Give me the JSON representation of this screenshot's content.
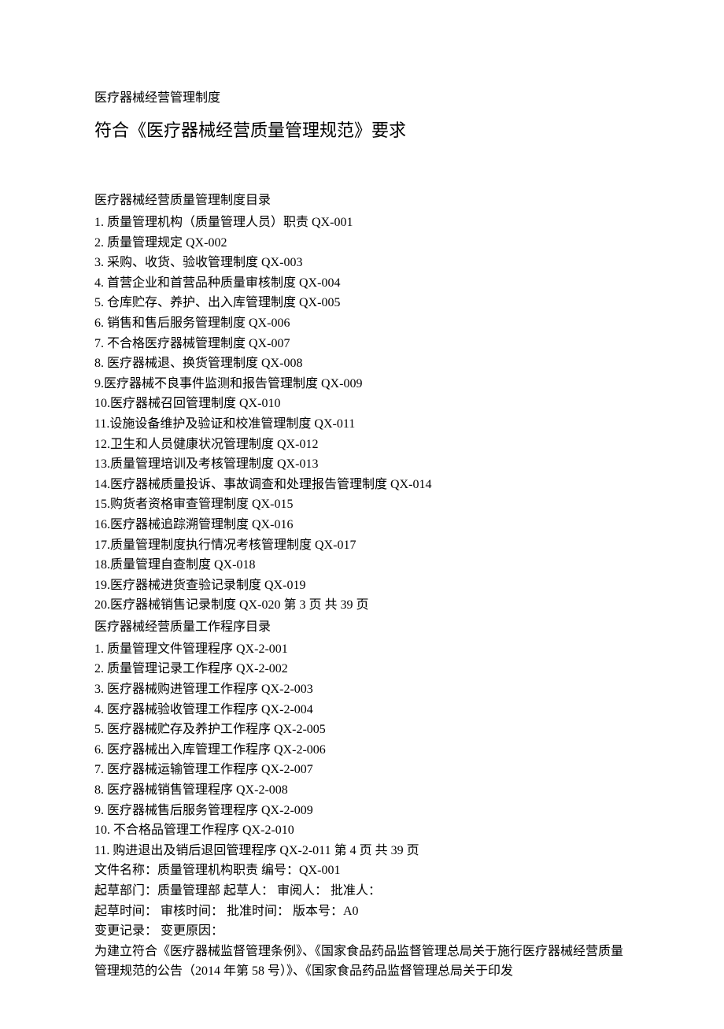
{
  "title_small": "医疗器械经营管理制度",
  "title_large": "符合《医疗器械经营质量管理规范》要求",
  "toc1_heading": "医疗器械经营质量管理制度目录",
  "toc1": {
    "i1": "1. 质量管理机构（质量管理人员）职责 QX-001",
    "i2": "2. 质量管理规定 QX-002",
    "i3": "3. 采购、收货、验收管理制度 QX-003",
    "i4": "4. 首营企业和首营品种质量审核制度 QX-004",
    "i5": "5. 仓库贮存、养护、出入库管理制度 QX-005",
    "i6": "6. 销售和售后服务管理制度 QX-006",
    "i7": "7. 不合格医疗器械管理制度 QX-007",
    "i8": "8. 医疗器械退、换货管理制度 QX-008",
    "i9": "9.医疗器械不良事件监测和报告管理制度 QX-009",
    "i10": "10.医疗器械召回管理制度 QX-010",
    "i11": "11.设施设备维护及验证和校准管理制度 QX-011",
    "i12": "12.卫生和人员健康状况管理制度 QX-012",
    "i13": "13.质量管理培训及考核管理制度 QX-013",
    "i14": "14.医疗器械质量投诉、事故调查和处理报告管理制度 QX-014",
    "i15": "15.购货者资格审查管理制度 QX-015",
    "i16": "16.医疗器械追踪溯管理制度 QX-016",
    "i17": "17.质量管理制度执行情况考核管理制度 QX-017",
    "i18": "18.质量管理自查制度 QX-018",
    "i19": "19.医疗器械进货查验记录制度 QX-019",
    "i20": "20.医疗器械销售记录制度 QX-020 第 3 页 共 39 页"
  },
  "toc2_heading": "医疗器械经营质量工作程序目录",
  "toc2": {
    "i1": "1. 质量管理文件管理程序 QX-2-001",
    "i2": "2. 质量管理记录工作程序 QX-2-002",
    "i3": "3. 医疗器械购进管理工作程序 QX-2-003",
    "i4": "4. 医疗器械验收管理工作程序 QX-2-004",
    "i5": "5. 医疗器械贮存及养护工作程序 QX-2-005",
    "i6": "6. 医疗器械出入库管理工作程序 QX-2-006",
    "i7": "7. 医疗器械运输管理工作程序 QX-2-007",
    "i8": "8. 医疗器械销售管理程序 QX-2-008",
    "i9": "9. 医疗器械售后服务管理程序 QX-2-009",
    "i10": "10. 不合格品管理工作程序 QX-2-010",
    "i11": "11. 购进退出及销后退回管理程序 QX-2-011 第 4 页 共 39 页"
  },
  "form": {
    "l1": "文件名称：质量管理机构职责 编号：QX-001",
    "l2": "起草部门：质量管理部 起草人：  审阅人：  批准人：",
    "l3": "起草时间：  审核时间：  批准时间：  版本号：A0",
    "l4": "变更记录：  变更原因："
  },
  "body": {
    "p1": "为建立符合《医疗器械监督管理条例》、《国家食品药品监督管理总局关于施行医疗器械经营质量管理规范的公告（2014 年第 58 号）》、《国家食品药品监督管理总局关于印发"
  }
}
